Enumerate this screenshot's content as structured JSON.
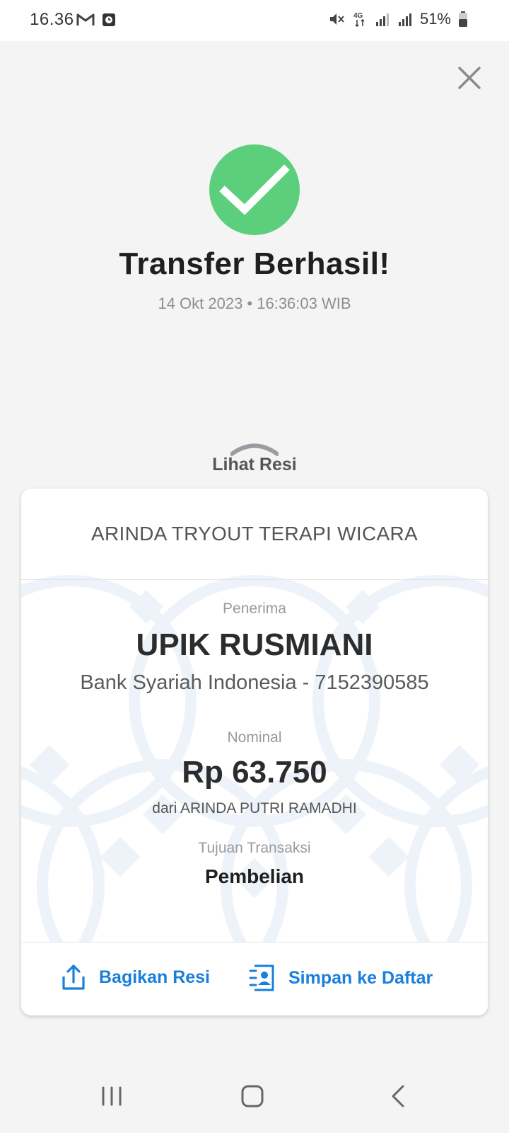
{
  "status_bar": {
    "time": "16.36",
    "battery": "51%",
    "network": "4G"
  },
  "icons": {
    "close": "close-icon",
    "success": "check-circle-icon",
    "chevron": "chevron-up-icon",
    "share": "share-icon",
    "save": "contact-add-icon"
  },
  "colors": {
    "success": "#5ccf7d",
    "accent": "#1a7fdb"
  },
  "header": {
    "title": "Transfer Berhasil!",
    "datetime": "14 Okt 2023 • 16:36:03 WIB"
  },
  "receipt_toggle": {
    "label": "Lihat Resi"
  },
  "receipt": {
    "merchant": "ARINDA TRYOUT TERAPI WICARA",
    "recipient_label": "Penerima",
    "recipient_name": "UPIK RUSMIANI",
    "recipient_bank": "Bank Syariah Indonesia - 7152390585",
    "amount_label": "Nominal",
    "amount": "Rp 63.750",
    "from": "dari ARINDA PUTRI RAMADHI",
    "purpose_label": "Tujuan Transaksi",
    "purpose": "Pembelian"
  },
  "actions": {
    "share_label": "Bagikan Resi",
    "save_label": "Simpan ke Daftar"
  }
}
